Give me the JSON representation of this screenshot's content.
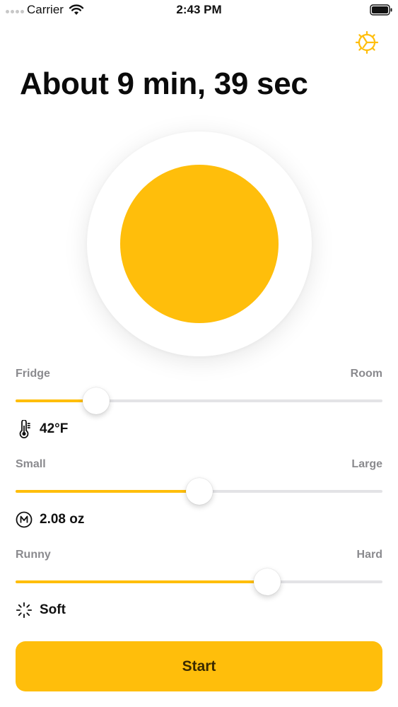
{
  "status_bar": {
    "carrier": "Carrier",
    "time": "2:43 PM",
    "icons": [
      "signal-dots-icon",
      "wifi-icon",
      "battery-icon"
    ]
  },
  "settings": {
    "icon": "settings-timer-icon",
    "color": "#FFBE0B"
  },
  "title": "About 9 min, 39 sec",
  "egg": {
    "white_color": "#FFFFFF",
    "yolk_color": "#FFBE0B"
  },
  "temperature": {
    "min_label": "Fridge",
    "max_label": "Room",
    "value_text": "42°F",
    "icon": "thermometer-icon",
    "level": 0.22
  },
  "size": {
    "min_label": "Small",
    "max_label": "Large",
    "value_text": "2.08 oz",
    "icon": "m-circle-icon",
    "level": 0.5
  },
  "doneness": {
    "min_label": "Runny",
    "max_label": "Hard",
    "value_text": "Soft",
    "icon": "spinner-icon",
    "level": 0.685
  },
  "start_button": {
    "label": "Start",
    "color": "#FFBE0B"
  }
}
